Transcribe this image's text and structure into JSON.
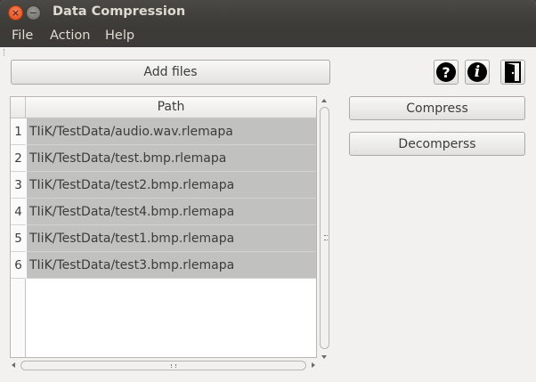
{
  "window": {
    "title": "Data Compression"
  },
  "titlebar_icons": {
    "close": "×",
    "minimize": "−"
  },
  "menu": {
    "items": [
      {
        "label": "File"
      },
      {
        "label": "Action"
      },
      {
        "label": "Help"
      }
    ]
  },
  "toolbar": {
    "add_files_label": "Add files",
    "help_glyph": "?",
    "info_glyph": "i"
  },
  "actions": {
    "compress_label": "Compress",
    "decompress_label": "Decomperss"
  },
  "table": {
    "column_header": "Path",
    "rows": [
      {
        "num": "1",
        "path": "TIiK/TestData/audio.wav.rlemapa"
      },
      {
        "num": "2",
        "path": "TIiK/TestData/test.bmp.rlemapa"
      },
      {
        "num": "3",
        "path": "TIiK/TestData/test2.bmp.rlemapa"
      },
      {
        "num": "4",
        "path": "TIiK/TestData/test4.bmp.rlemapa"
      },
      {
        "num": "5",
        "path": "TIiK/TestData/test1.bmp.rlemapa"
      },
      {
        "num": "6",
        "path": "TIiK/TestData/test3.bmp.rlemapa"
      }
    ]
  },
  "colors": {
    "titlebar": "#3c3b37",
    "selection": "#c1c1c0",
    "close_button": "#df4a16"
  }
}
